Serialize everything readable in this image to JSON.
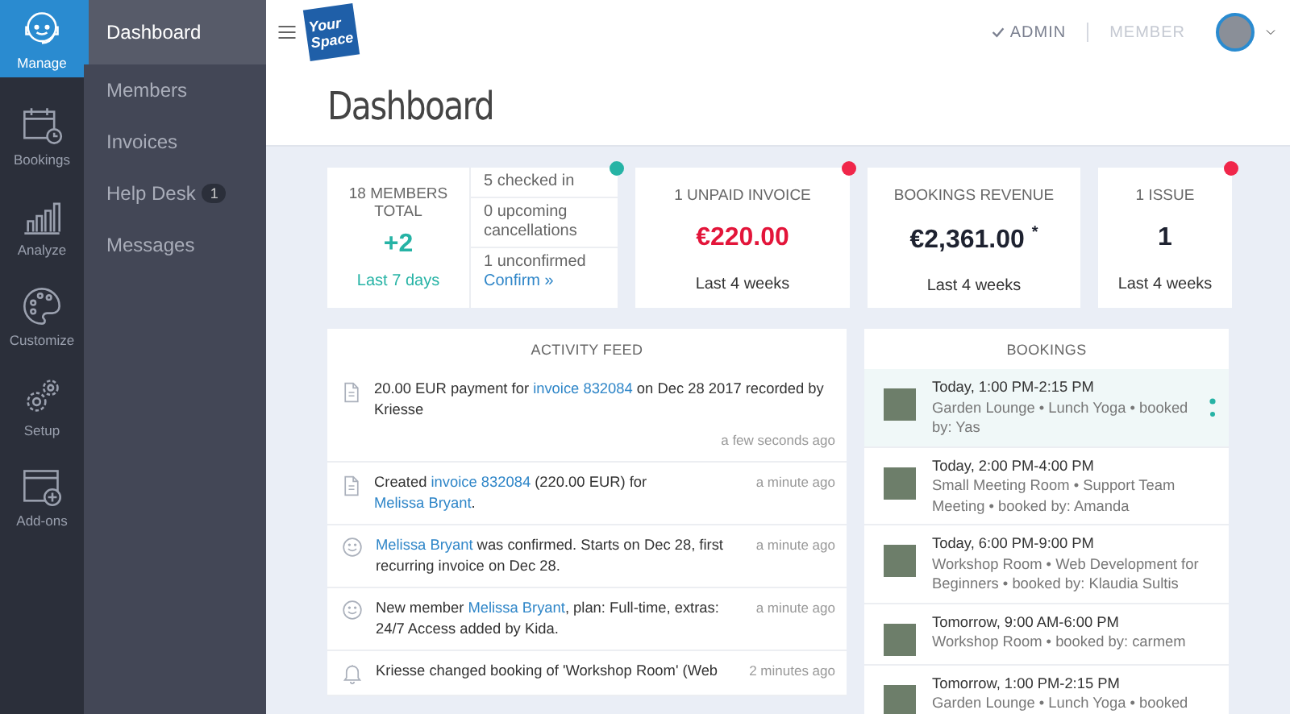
{
  "rail": [
    {
      "label": "Manage",
      "selected": true
    },
    {
      "label": "Bookings",
      "selected": false
    },
    {
      "label": "Analyze",
      "selected": false
    },
    {
      "label": "Customize",
      "selected": false
    },
    {
      "label": "Setup",
      "selected": false
    },
    {
      "label": "Add-ons",
      "selected": false
    }
  ],
  "subnav": [
    {
      "label": "Dashboard",
      "selected": true
    },
    {
      "label": "Members",
      "selected": false
    },
    {
      "label": "Invoices",
      "selected": false
    },
    {
      "label": "Help Desk",
      "badge": "1",
      "selected": false
    },
    {
      "label": "Messages",
      "selected": false
    }
  ],
  "header": {
    "logo": [
      "Your",
      "Space"
    ],
    "roles": [
      {
        "label": "ADMIN",
        "selected": true
      },
      {
        "label": "MEMBER",
        "selected": false
      }
    ],
    "title": "Dashboard"
  },
  "members_card": {
    "title": "18 MEMBERS TOTAL",
    "value": "+2",
    "period": "Last 7 days",
    "color": "#26b3a5",
    "stats": [
      "5 checked in",
      "0 upcoming cancellations",
      "1 unconfirmed"
    ],
    "link": "Confirm »"
  },
  "stat_cards": [
    {
      "title": "1 UNPAID INVOICE",
      "value": "€220.00",
      "kind": "alert",
      "period": "Last 4 weeks",
      "color": "#f0264a"
    },
    {
      "title": "BOOKINGS REVENUE",
      "value": "€2,361.00",
      "note": "*",
      "kind": "normal",
      "period": "Last 4 weeks"
    },
    {
      "title": "1 ISSUE",
      "value": "1",
      "kind": "normal",
      "period": "Last 4 weeks",
      "color": "#f0264a"
    }
  ],
  "activity_feed": {
    "title": "ACTIVITY FEED",
    "items": [
      {
        "kind": "document",
        "time_below": true,
        "time": "a few seconds ago",
        "parts": [
          {
            "t": "20.00 EUR payment for ",
            "link": false
          },
          {
            "t": "invoice 832084",
            "link": true
          },
          {
            "t": " on Dec 28 2017 recorded by Kriesse",
            "link": false
          }
        ]
      },
      {
        "kind": "document",
        "time_below": false,
        "time": "a minute ago",
        "parts": [
          {
            "t": "Created ",
            "link": false
          },
          {
            "t": "invoice 832084",
            "link": true
          },
          {
            "t": " (220.00 EUR) for ",
            "link": false
          },
          {
            "t": "Melissa Bryant",
            "link": true
          },
          {
            "t": ".",
            "link": false
          }
        ]
      },
      {
        "kind": "smiley",
        "time_below": false,
        "time": "a minute ago",
        "parts": [
          {
            "t": "Melissa Bryant",
            "link": true
          },
          {
            "t": " was confirmed. Starts on Dec 28, first recurring invoice on Dec 28.",
            "link": false
          }
        ]
      },
      {
        "kind": "smiley",
        "time_below": false,
        "time": "a minute ago",
        "parts": [
          {
            "t": "New member ",
            "link": false
          },
          {
            "t": "Melissa Bryant",
            "link": true
          },
          {
            "t": ", plan: Full-time, extras: 24/7 Access added by Kida.",
            "link": false
          }
        ]
      },
      {
        "kind": "bell",
        "time_below": false,
        "time": "2 minutes ago",
        "parts": [
          {
            "t": "Kriesse changed booking of 'Workshop Room' (Web",
            "link": false
          }
        ]
      }
    ]
  },
  "bookings": {
    "title": "BOOKINGS",
    "items": [
      {
        "time": "Today, 1:00 PM-2:15 PM",
        "details": "Garden Lounge • Lunch Yoga • booked by: Yas",
        "selected": true
      },
      {
        "time": "Today, 2:00 PM-4:00 PM",
        "details": "Small Meeting Room • Support Team Meeting • booked by: Amanda",
        "selected": false
      },
      {
        "time": "Today, 6:00 PM-9:00 PM",
        "details": "Workshop Room • Web Development for Beginners • booked by: Klaudia Sultis",
        "selected": false
      },
      {
        "time": "Tomorrow, 9:00 AM-6:00 PM",
        "details": "Workshop Room • booked by: carmem",
        "selected": false
      },
      {
        "time": "Tomorrow, 1:00 PM-2:15 PM",
        "details": "Garden Lounge • Lunch Yoga • booked",
        "selected": false
      }
    ]
  }
}
